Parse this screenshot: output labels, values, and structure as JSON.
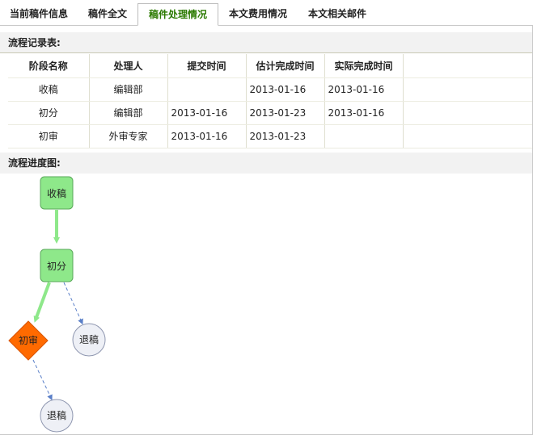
{
  "tabs": [
    {
      "label": "当前稿件信息"
    },
    {
      "label": "稿件全文"
    },
    {
      "label": "稿件处理情况"
    },
    {
      "label": "本文费用情况"
    },
    {
      "label": "本文相关邮件"
    }
  ],
  "record": {
    "title": "流程记录表:",
    "headers": [
      "阶段名称",
      "处理人",
      "提交时间",
      "估计完成时间",
      "实际完成时间"
    ],
    "rows": [
      [
        "收稿",
        "编辑部",
        "",
        "2013-01-16",
        "2013-01-16"
      ],
      [
        "初分",
        "编辑部",
        "2013-01-16",
        "2013-01-23",
        "2013-01-16"
      ],
      [
        "初审",
        "外审专家",
        "2013-01-16",
        "2013-01-23",
        ""
      ]
    ]
  },
  "flow": {
    "title": "流程进度图:",
    "nodes": {
      "receive": "收稿",
      "assign": "初分",
      "review": "初审",
      "reject1": "退稿",
      "reject2": "退稿"
    },
    "colors": {
      "done_fill": "#8ee88a",
      "done_border": "#5aa85a",
      "current_fill": "#ff6a00",
      "pending_fill": "#eef0f6",
      "pending_border": "#8f97b0",
      "done_arrow": "#8ee88a",
      "pending_arrow": "#5a7fc8"
    }
  }
}
